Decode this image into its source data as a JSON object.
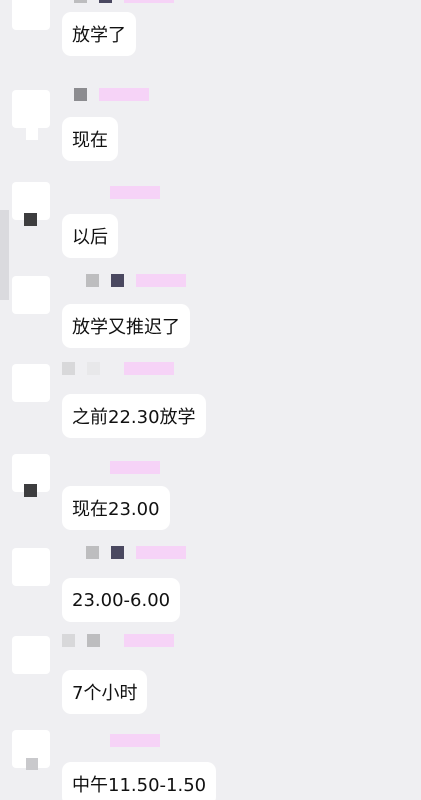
{
  "colors": {
    "background": "#efeff2",
    "bubble": "#ffffff",
    "name_bar": "#f6d3f7",
    "name_square_dark": "#4a4860",
    "name_square_gray": "#bdbdbf"
  },
  "messages": [
    {
      "text": "放学了"
    },
    {
      "text": "现在"
    },
    {
      "text": "以后"
    },
    {
      "text": "放学又推迟了"
    },
    {
      "text": "之前22.30放学"
    },
    {
      "text": "现在23.00"
    },
    {
      "text": "23.00-6.00"
    },
    {
      "text": "7个小时"
    },
    {
      "text": "中午11.50-1.50"
    }
  ]
}
